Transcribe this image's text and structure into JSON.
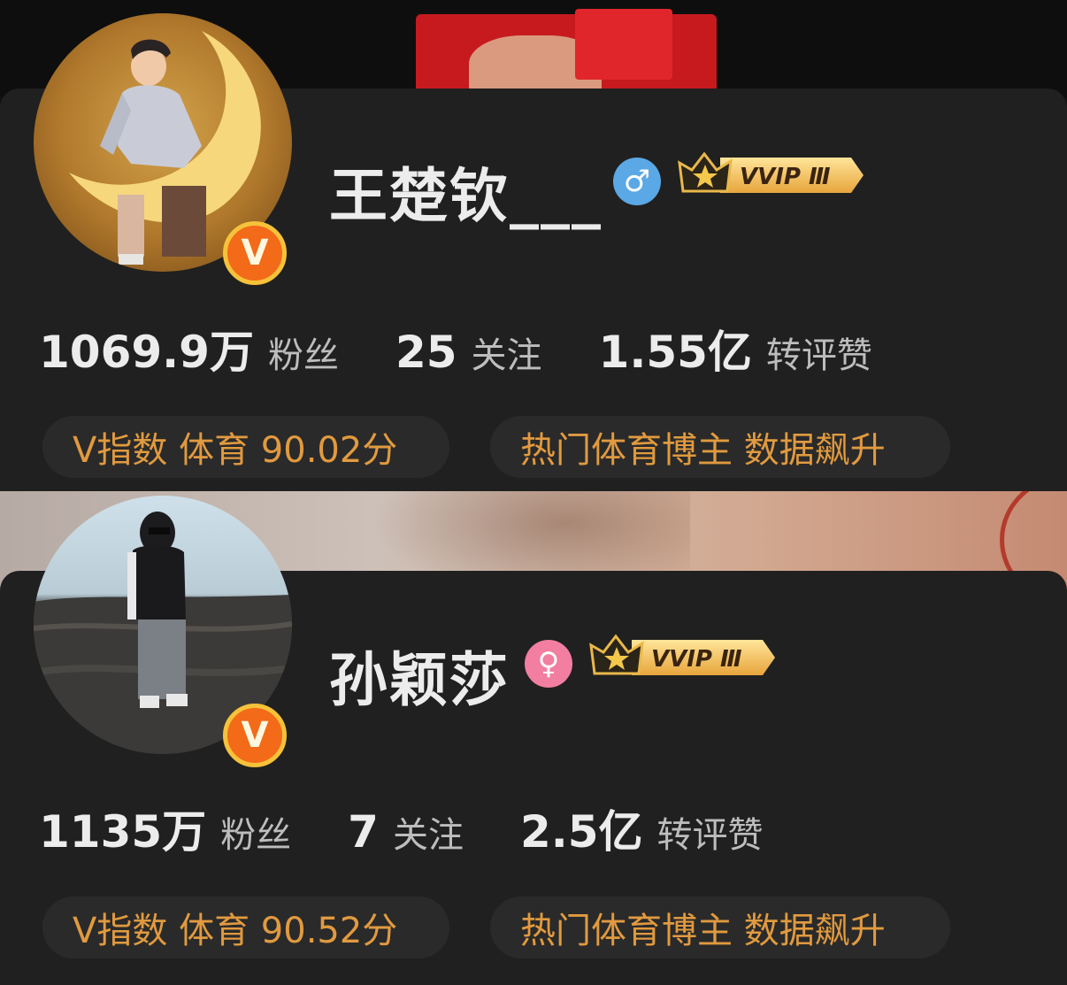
{
  "profiles": [
    {
      "name": "王楚钦___",
      "gender_symbol": "♂",
      "gender_color": "#5aa8e6",
      "verified_badge": "V",
      "vip_label": "VVIP Ⅲ",
      "stats": [
        {
          "value": "1069.9万",
          "label": "粉丝"
        },
        {
          "value": "25",
          "label": "关注"
        },
        {
          "value": "1.55亿",
          "label": "转评赞"
        }
      ],
      "tags": [
        "V指数 体育 90.02分",
        "热门体育博主 数据飙升"
      ]
    },
    {
      "name": "孙颖莎",
      "gender_symbol": "♀",
      "gender_color": "#f27ea2",
      "verified_badge": "V",
      "vip_label": "VVIP Ⅲ",
      "stats": [
        {
          "value": "1135万",
          "label": "粉丝"
        },
        {
          "value": "7",
          "label": "关注"
        },
        {
          "value": "2.5亿",
          "label": "转评赞"
        }
      ],
      "tags": [
        "V指数 体育 90.52分",
        "热门体育博主 数据飙升"
      ]
    }
  ],
  "colors": {
    "accent": "#e19a3f",
    "badge_orange": "#f36a18",
    "gold": "#f6c23a"
  }
}
